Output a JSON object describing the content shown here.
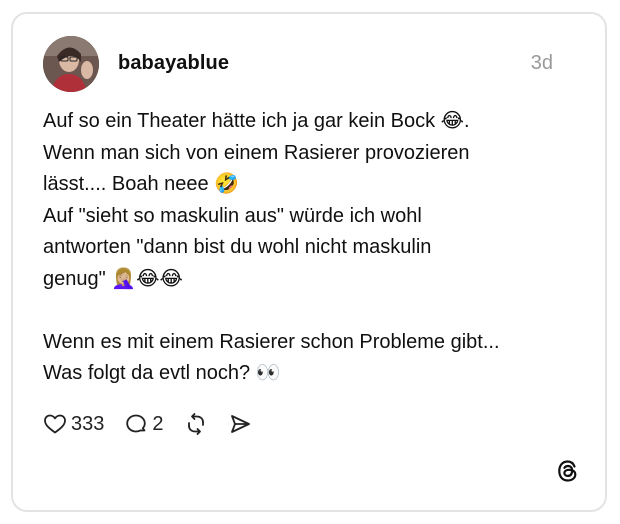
{
  "post": {
    "username": "babayablue",
    "timestamp": "3d",
    "lines": [
      "Auf so ein Theater hätte ich ja gar kein Bock 😂.",
      "Wenn man sich von einem Rasierer provozieren",
      "lässt.... Boah neee 🤣",
      "Auf \"sieht so maskulin aus\" würde ich wohl",
      "antworten \"dann bist du wohl nicht maskulin",
      "genug\" 🤦🏼‍♀️😂😂",
      "",
      "Wenn es mit einem Rasierer schon Probleme gibt...",
      "Was folgt da evtl noch? 👀"
    ]
  },
  "actions": {
    "likes": "333",
    "replies": "2"
  },
  "icons": {
    "like": "heart-outline-icon",
    "reply": "speech-bubble-icon",
    "repost": "repost-arrows-icon",
    "share": "paper-plane-icon",
    "brand": "threads-logo-icon"
  },
  "colors": {
    "text": "#101010",
    "muted": "#999999",
    "border": "#e3e3e3"
  }
}
